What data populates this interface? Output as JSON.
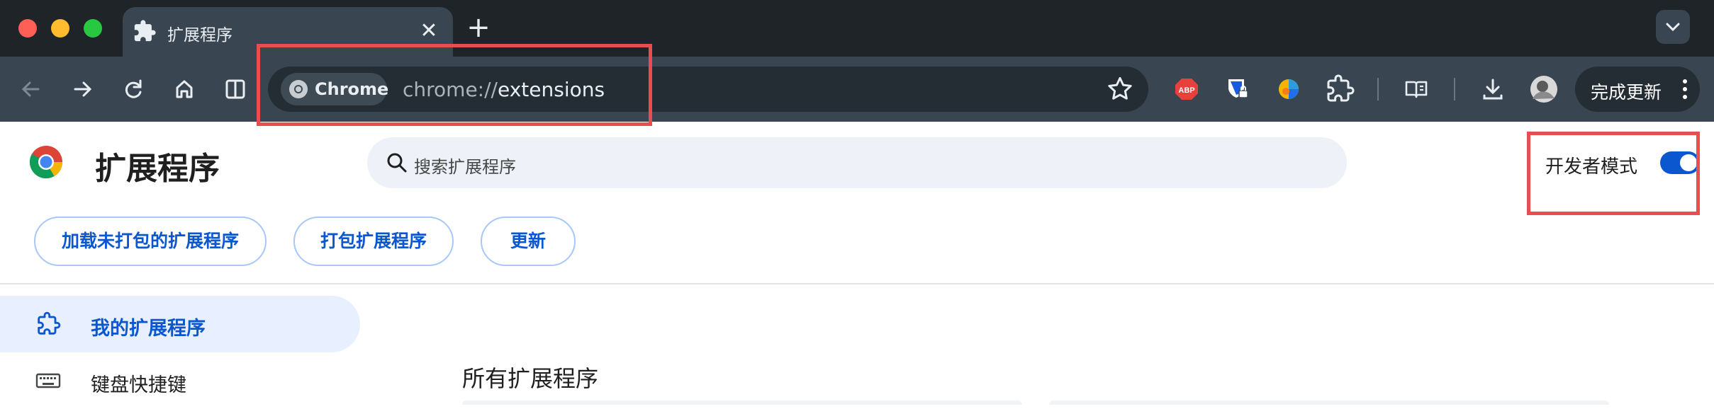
{
  "browser": {
    "tab": {
      "title": "扩展程序",
      "icon": "puzzle-icon",
      "close_label": "✕"
    },
    "new_tab_label": "+",
    "omnibox": {
      "chip_label": "Chrome",
      "url_scheme": "chrome://",
      "url_path": "extensions"
    },
    "extension_icons": [
      "adblock-plus-icon",
      "bitwarden-icon",
      "colorful-extension-icon",
      "extensions-puzzle-icon"
    ],
    "update_button_label": "完成更新"
  },
  "header": {
    "title": "扩展程序",
    "search_placeholder": "搜索扩展程序",
    "developer_mode_label": "开发者模式",
    "developer_mode_enabled": true
  },
  "actions": [
    {
      "label": "加载未打包的扩展程序"
    },
    {
      "label": "打包扩展程序"
    },
    {
      "label": "更新"
    }
  ],
  "sidebar": {
    "items": [
      {
        "label": "我的扩展程序",
        "icon": "puzzle-icon",
        "active": true
      },
      {
        "label": "键盘快捷键",
        "icon": "keyboard-icon",
        "active": false
      }
    ]
  },
  "main": {
    "section_title": "所有扩展程序"
  },
  "colors": {
    "accent": "#0b57d0",
    "toolbar": "#394651",
    "tabstrip": "#1f2428",
    "highlight_box": "#e84e4f"
  }
}
